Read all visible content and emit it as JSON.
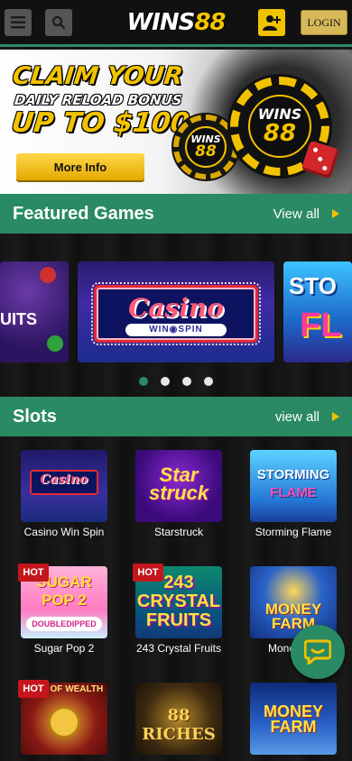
{
  "header": {
    "logo_text": "WINS",
    "logo_number": "88",
    "login_label": "LOGIN",
    "icons": [
      "menu-icon",
      "search-icon",
      "register-user-icon"
    ]
  },
  "banner": {
    "line1": "CLAIM YOUR",
    "line2": "DAILY RELOAD BONUS",
    "line3": "UP TO $100",
    "button_label": "More Info",
    "chip_big_word": "WINS",
    "chip_big_number": "88",
    "chip_small_word": "WINS",
    "chip_small_number": "88"
  },
  "featured": {
    "title": "Featured Games",
    "view_all": "View all",
    "carousel": {
      "left_partial": "UITS",
      "main_title": "Casino",
      "main_subtitle": "WIN◉SPIN",
      "right_partial_top": "STO",
      "right_partial_bottom": "FL"
    },
    "pagination": {
      "count": 4,
      "active_index": 0
    }
  },
  "slots": {
    "title": "Slots",
    "view_all": "view all",
    "games": [
      {
        "name": "Casino Win Spin",
        "hot": false,
        "thumb_text": "Casino"
      },
      {
        "name": "Starstruck",
        "hot": false,
        "thumb_text": "Star struck"
      },
      {
        "name": "Storming Flame",
        "hot": false,
        "thumb_text": "STORMING",
        "thumb_text2": "FLAME"
      },
      {
        "name": "Sugar Pop 2",
        "hot": true,
        "thumb_text": "SUGAR POP 2",
        "thumb_text2": "DOUBLEDIPPED"
      },
      {
        "name": "243 Crystal Fruits",
        "hot": true,
        "thumb_text": "243 CRYSTAL FRUITS"
      },
      {
        "name": "Money",
        "hot": false,
        "thumb_text": "MONEY FARM"
      },
      {
        "name": "",
        "hot": true,
        "thumb_text": "KING OF WEALTH"
      },
      {
        "name": "",
        "hot": false,
        "thumb_text": "88 RICHES"
      },
      {
        "name": "",
        "hot": false,
        "thumb_text": "MONEY FARM"
      }
    ],
    "hot_label": "HOT"
  },
  "colors": {
    "accent_green": "#2a8a64",
    "gold": "#f3c300",
    "hot_red": "#c4161c"
  }
}
